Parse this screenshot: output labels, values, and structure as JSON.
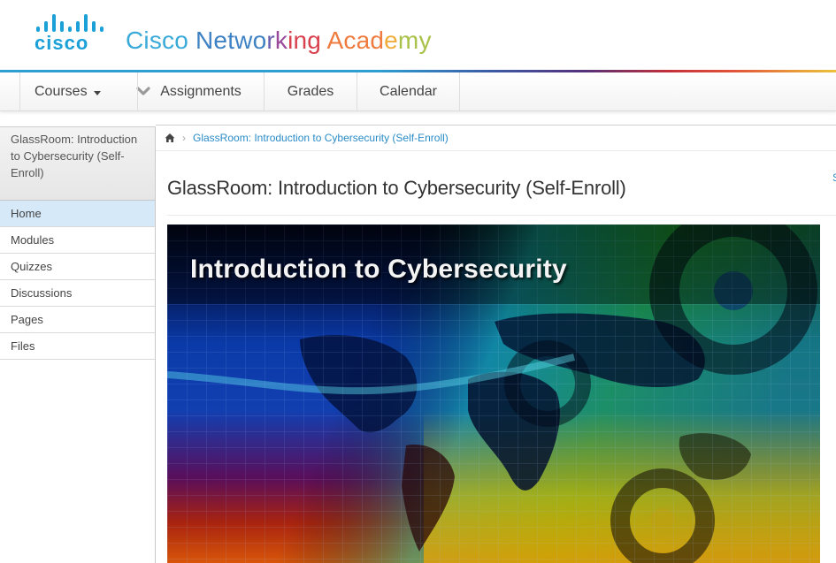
{
  "brand": {
    "logo_text": "cisco",
    "title_segments": [
      {
        "text": "Cisco ",
        "color": "#3aaad9"
      },
      {
        "text": "Netwo",
        "color": "#3f82c4"
      },
      {
        "text": "r",
        "color": "#6a5fae"
      },
      {
        "text": "k",
        "color": "#9a4a9a"
      },
      {
        "text": "ing ",
        "color": "#d9414e"
      },
      {
        "text": "Acad",
        "color": "#ef7b3e"
      },
      {
        "text": "e",
        "color": "#f0ad3c"
      },
      {
        "text": "my",
        "color": "#a8c24a"
      }
    ]
  },
  "nav": {
    "items": [
      {
        "label": "Courses",
        "has_caret": true
      },
      {
        "label": "Assignments"
      },
      {
        "label": "Grades"
      },
      {
        "label": "Calendar"
      }
    ]
  },
  "sidebar": {
    "course_title": "GlassRoom: Introduction to Cybersecurity (Self-Enroll)",
    "items": [
      {
        "label": "Home",
        "active": true
      },
      {
        "label": "Modules"
      },
      {
        "label": "Quizzes"
      },
      {
        "label": "Discussions"
      },
      {
        "label": "Pages"
      },
      {
        "label": "Files"
      }
    ]
  },
  "breadcrumb": {
    "home_icon": "home-icon",
    "separator": "›",
    "current": "GlassRoom: Introduction to Cybersecurity (Self-Enroll)"
  },
  "main": {
    "page_title": "GlassRoom: Introduction to Cybersecurity (Self-Enroll)",
    "right_stub": "S",
    "banner_title": "Introduction to Cybersecurity"
  }
}
